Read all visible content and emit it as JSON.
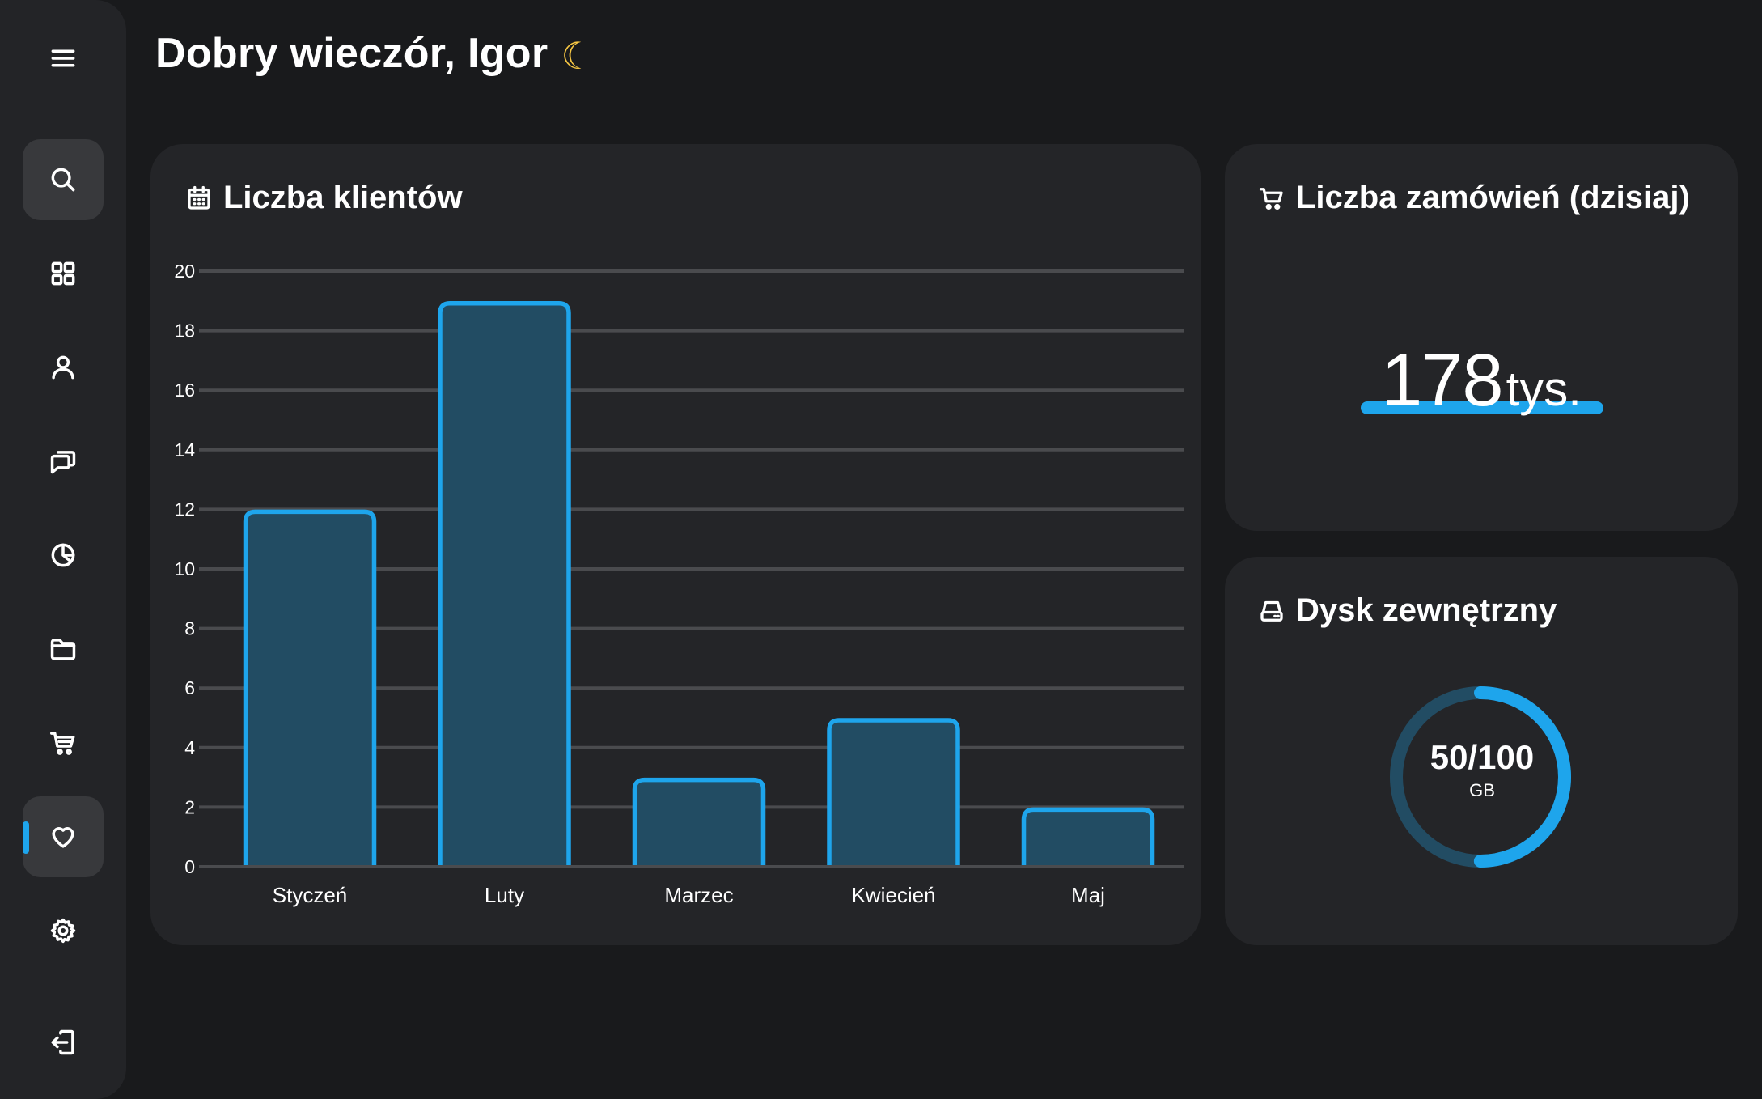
{
  "header": {
    "greeting": "Dobry wieczór, Igor",
    "greeting_icon": "moon-emoji"
  },
  "sidebar": {
    "items": [
      {
        "name": "menu",
        "icon": "hamburger-icon"
      },
      {
        "name": "search",
        "icon": "search-icon"
      },
      {
        "name": "dashboard",
        "icon": "grid-icon"
      },
      {
        "name": "users",
        "icon": "user-icon"
      },
      {
        "name": "messages",
        "icon": "chat-icon"
      },
      {
        "name": "analytics",
        "icon": "pie-chart-icon"
      },
      {
        "name": "files",
        "icon": "folder-icon"
      },
      {
        "name": "shop",
        "icon": "cart-icon"
      },
      {
        "name": "favorites",
        "icon": "heart-icon",
        "active": true
      },
      {
        "name": "settings",
        "icon": "gear-icon"
      },
      {
        "name": "logout",
        "icon": "logout-icon"
      }
    ]
  },
  "clients_card": {
    "title": "Liczba klientów",
    "icon": "calendar-icon"
  },
  "orders_card": {
    "title": "Liczba zamówień (dzisiaj)",
    "icon": "cart-icon",
    "value": "178",
    "unit": "tys."
  },
  "disk_card": {
    "title": "Dysk zewnętrzny",
    "icon": "hard-drive-icon",
    "used": 50,
    "total": 100,
    "value_text": "50/100",
    "unit": "GB"
  },
  "colors": {
    "accent": "#1ea5ec",
    "bar_fill": "#224c63",
    "card_bg": "#242528",
    "page_bg": "#191a1c",
    "grid": "#4a4b4e",
    "track": "#224c63"
  },
  "chart_data": {
    "type": "bar",
    "categories": [
      "Styczeń",
      "Luty",
      "Marzec",
      "Kwiecień",
      "Maj"
    ],
    "values": [
      12,
      19,
      3,
      5,
      2
    ],
    "ylim": [
      0,
      20
    ],
    "yticks": [
      0,
      2,
      4,
      6,
      8,
      10,
      12,
      14,
      16,
      18,
      20
    ],
    "grid": true,
    "legend": "none"
  }
}
